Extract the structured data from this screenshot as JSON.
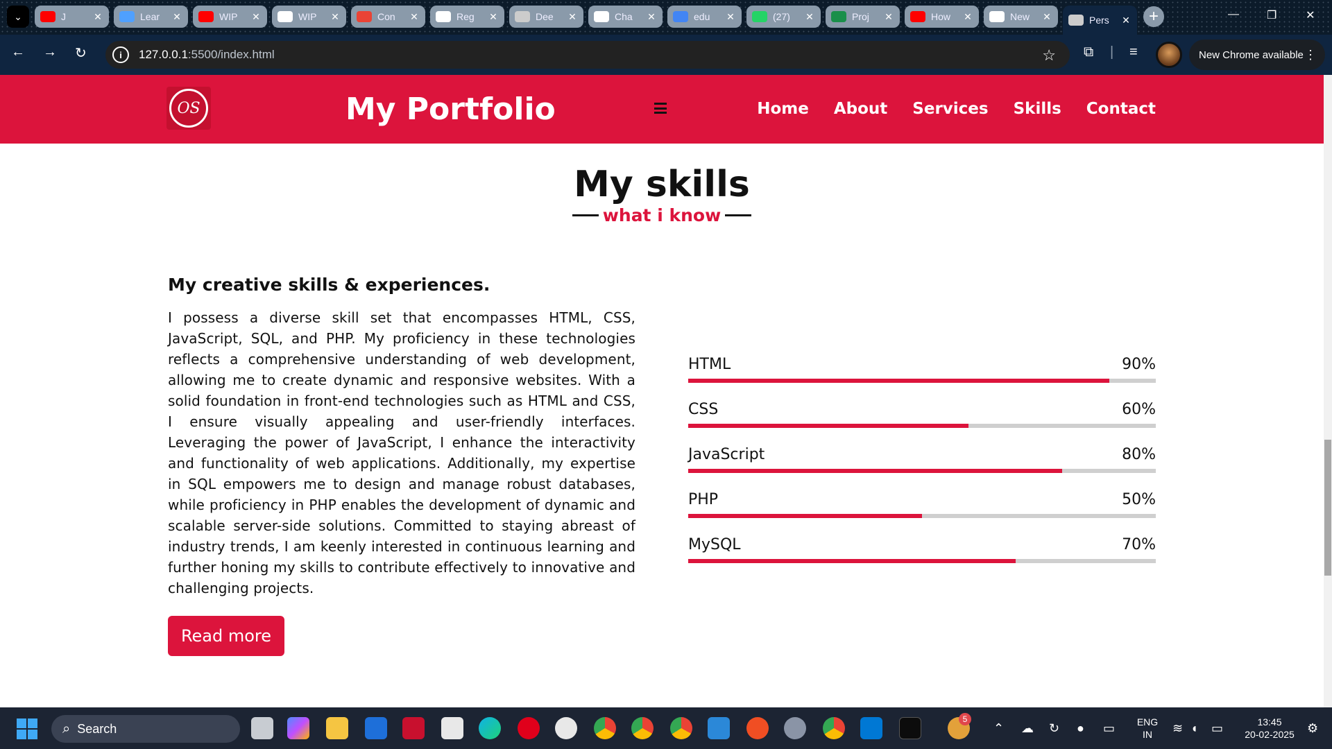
{
  "browser": {
    "tabs": [
      {
        "title": "J",
        "favicon": "youtube-icon",
        "color": "#ff0000"
      },
      {
        "title": "Lear",
        "favicon": "codepen-icon",
        "color": "#4fa0ff"
      },
      {
        "title": "WIP",
        "favicon": "youtube-icon",
        "color": "#ff0000"
      },
      {
        "title": "WIP",
        "favicon": "wordpress-icon",
        "color": "#ffffff"
      },
      {
        "title": "Con",
        "favicon": "gmail-icon",
        "color": "#ea4335"
      },
      {
        "title": "Reg",
        "favicon": "chatgpt-icon",
        "color": "#ffffff"
      },
      {
        "title": "Dee",
        "favicon": "globe-icon",
        "color": "#cccccc"
      },
      {
        "title": "Cha",
        "favicon": "chatgpt-icon",
        "color": "#ffffff"
      },
      {
        "title": "edu",
        "favicon": "google-icon",
        "color": "#4285f4"
      },
      {
        "title": "(27)",
        "favicon": "whatsapp-icon",
        "color": "#25d366"
      },
      {
        "title": "Proj",
        "favicon": "leaf-icon",
        "color": "#1a8f4a"
      },
      {
        "title": "How",
        "favicon": "youtube-icon",
        "color": "#ff0000"
      },
      {
        "title": "New",
        "favicon": "chrome-icon",
        "color": "#ffffff"
      },
      {
        "title": "Pers",
        "favicon": "globe-icon",
        "color": "#cccccc",
        "active": true
      }
    ],
    "url_host": "127.0.0.1",
    "url_path": ":5500/index.html",
    "update_label": "New Chrome available"
  },
  "site": {
    "brand": "My Portfolio",
    "logo_text": "OS",
    "nav": [
      "Home",
      "About",
      "Services",
      "Skills",
      "Contact"
    ],
    "accent": "#dc143c"
  },
  "skills_section": {
    "title": "My skills",
    "subtitle": "what i know",
    "heading": "My creative skills & experiences.",
    "paragraph": "I possess a diverse skill set that encompasses HTML, CSS, JavaScript, SQL, and PHP. My proficiency in these technologies reflects a comprehensive understanding of web development, allowing me to create dynamic and responsive websites. With a solid foundation in front-end technologies such as HTML and CSS, I ensure visually appealing and user-friendly interfaces. Leveraging the power of JavaScript, I enhance the interactivity and functionality of web applications. Additionally, my expertise in SQL empowers me to design and manage robust databases, while proficiency in PHP enables the development of dynamic and scalable server-side solutions. Committed to staying abreast of industry trends, I am keenly interested in continuous learning and further honing my skills to contribute effectively to innovative and challenging projects.",
    "button": "Read more",
    "skills": [
      {
        "name": "HTML",
        "percent_label": "90%",
        "value": 90
      },
      {
        "name": "CSS",
        "percent_label": "60%",
        "value": 60
      },
      {
        "name": "JavaScript",
        "percent_label": "80%",
        "value": 80
      },
      {
        "name": "PHP",
        "percent_label": "50%",
        "value": 50
      },
      {
        "name": "MySQL",
        "percent_label": "70%",
        "value": 70
      }
    ]
  },
  "taskbar": {
    "search_label": "Search",
    "lang_line1": "ENG",
    "lang_line2": "IN",
    "time": "13:45",
    "date": "20-02-2025",
    "badge_count": "5"
  }
}
